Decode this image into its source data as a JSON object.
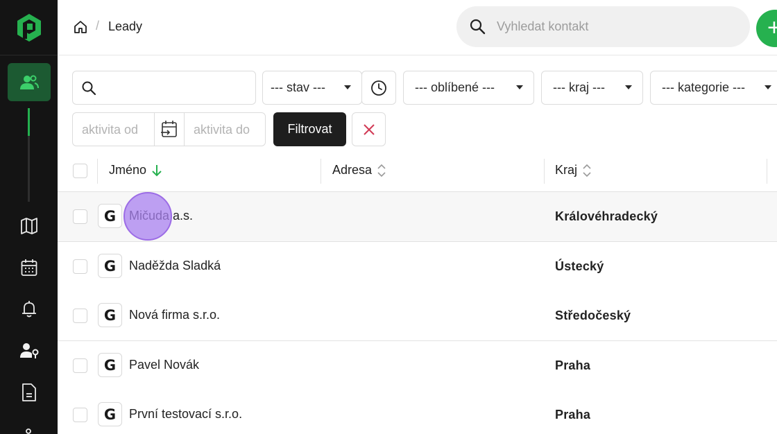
{
  "header": {
    "breadcrumb_current": "Leady",
    "breadcrumb_separator": "/",
    "search_placeholder": "Vyhledat kontakt",
    "add_label": "+"
  },
  "filters": {
    "stav": "--- stav ---",
    "oblibene": "--- oblíbené ---",
    "kraj": "--- kraj ---",
    "kategorie": "--- kategorie ---",
    "activity_from_placeholder": "aktivita od",
    "activity_to_placeholder": "aktivita do",
    "filter_button": "Filtrovat"
  },
  "table": {
    "columns": {
      "name": "Jméno",
      "address": "Adresa",
      "region": "Kraj"
    },
    "rows": [
      {
        "badge": "G",
        "name": "Mičuda a.s.",
        "address": "",
        "region": "Královéhradecký"
      },
      {
        "badge": "G",
        "name": "Naděžda Sladká",
        "address": "",
        "region": "Ústecký"
      },
      {
        "badge": "G",
        "name": "Nová firma s.r.o.",
        "address": "",
        "region": "Středočeský"
      },
      {
        "badge": "G",
        "name": "Pavel Novák",
        "address": "",
        "region": "Praha"
      },
      {
        "badge": "G",
        "name": "První testovací s.r.o.",
        "address": "",
        "region": "Praha"
      }
    ]
  },
  "colors": {
    "accent_green": "#26b14f",
    "sidebar_bg": "#141414",
    "active_nav_bg": "#1c5a32",
    "clear_red": "#d13a55"
  },
  "icons": {
    "sidebar": [
      "logo-icon",
      "users-icon",
      "map-icon",
      "calendar-icon",
      "bell-icon",
      "user-key-icon",
      "document-icon"
    ]
  }
}
